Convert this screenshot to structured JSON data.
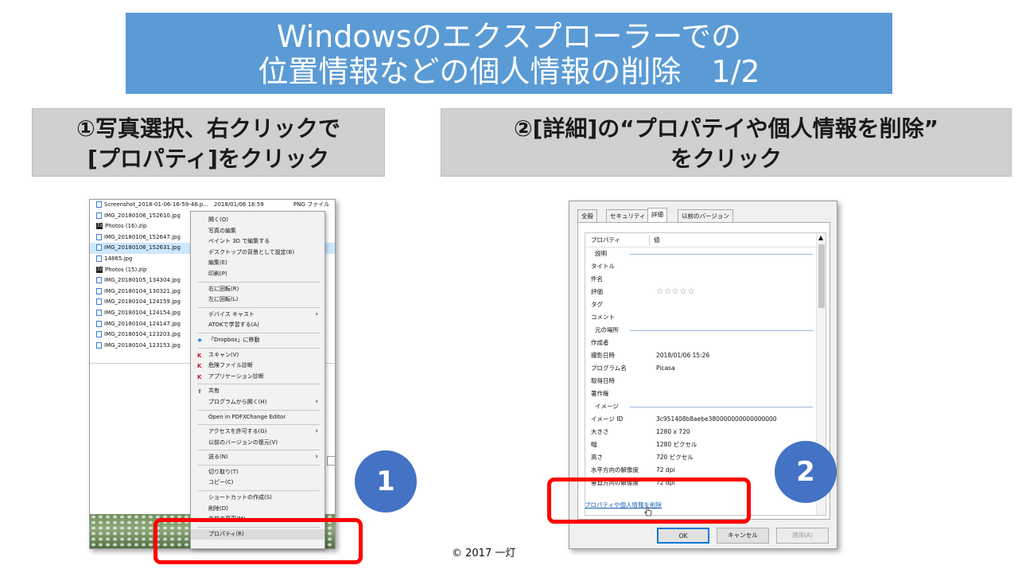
{
  "title": {
    "line1": "Windowsのエクスプローラーでの",
    "line2": "位置情報などの個人情報の削除　1/2"
  },
  "step1": {
    "line1": "①写真選択、右クリックで",
    "line2": "[プロパティ]をクリック"
  },
  "step2": {
    "line1": "②[詳細]の“プロパテイや個人情報を削除”",
    "line2": "をクリック"
  },
  "markers": {
    "one": "1",
    "two": "2"
  },
  "copyright": "© 2017 一灯",
  "explorer": {
    "files": [
      {
        "name": "Screenshot_2018-01-06-16-59-46.p...",
        "date": "2018/01/06 16:59",
        "type": "PNG ファイル",
        "icon": "image-file-icon"
      },
      {
        "name": "IMG_20180106_152610.jpg",
        "icon": "image-file-icon"
      },
      {
        "name": "Photos (16).zip",
        "icon": "zip-file-icon"
      },
      {
        "name": "IMG_20180106_152647.jpg",
        "icon": "image-file-icon"
      },
      {
        "name": "IMG_20180106_152631.jpg",
        "icon": "image-file-icon",
        "selected": true
      },
      {
        "name": "14865.jpg",
        "icon": "image-file-icon"
      },
      {
        "name": "Photos (15).zip",
        "icon": "zip-file-icon"
      },
      {
        "name": "IMG_20180105_134304.jpg",
        "icon": "image-file-icon"
      },
      {
        "name": "IMG_20180104_130321.jpg",
        "icon": "image-file-icon"
      },
      {
        "name": "IMG_20180104_124159.jpg",
        "icon": "image-file-icon"
      },
      {
        "name": "IMG_20180104_124154.jpg",
        "icon": "image-file-icon"
      },
      {
        "name": "IMG_20180104_124147.jpg",
        "icon": "image-file-icon"
      },
      {
        "name": "IMG_20180104_123203.jpg",
        "icon": "image-file-icon"
      },
      {
        "name": "IMG_20180104_123153.jpg",
        "icon": "image-file-icon"
      }
    ]
  },
  "context_menu": {
    "items": [
      {
        "label": "開く(O)"
      },
      {
        "label": "写真の編集"
      },
      {
        "label": "ペイント 3D で編集する"
      },
      {
        "label": "デスクトップの背景として設定(B)"
      },
      {
        "label": "編集(E)"
      },
      {
        "label": "印刷(P)"
      },
      {
        "sep": true
      },
      {
        "label": "右に回転(R)"
      },
      {
        "label": "左に回転(L)"
      },
      {
        "sep": true
      },
      {
        "label": "デバイス キャスト",
        "submenu": true
      },
      {
        "label": "ATOKで学習する(A)"
      },
      {
        "sep": true
      },
      {
        "label": "「Dropbox」に移動",
        "icon": "dropbox-icon",
        "glyph": "❖",
        "color": "#0061ff"
      },
      {
        "sep": true
      },
      {
        "label": "スキャン(V)",
        "icon": "kaspersky-icon",
        "glyph": "K",
        "color": "#c8102e"
      },
      {
        "label": "危険ファイル診断",
        "icon": "kaspersky-icon",
        "glyph": "K",
        "color": "#c8102e"
      },
      {
        "label": "アプリケーション診断",
        "icon": "kaspersky-icon",
        "glyph": "K",
        "color": "#c8102e"
      },
      {
        "sep": true
      },
      {
        "label": "共有",
        "icon": "share-icon",
        "glyph": "⇪",
        "color": "#333333"
      },
      {
        "label": "プログラムから開く(H)",
        "submenu": true
      },
      {
        "sep": true
      },
      {
        "label": "Open in PDFXChange Editor"
      },
      {
        "sep": true
      },
      {
        "label": "アクセスを許可する(G)",
        "submenu": true
      },
      {
        "label": "以前のバージョンの復元(V)"
      },
      {
        "sep": true
      },
      {
        "label": "送る(N)",
        "submenu": true
      },
      {
        "sep": true
      },
      {
        "label": "切り取り(T)"
      },
      {
        "label": "コピー(C)"
      },
      {
        "sep": true
      },
      {
        "label": "ショートカットの作成(S)"
      },
      {
        "label": "削除(D)"
      },
      {
        "label": "名前の変更(M)"
      },
      {
        "sep": true
      },
      {
        "label": "プロパティ(R)",
        "highlight": true
      }
    ]
  },
  "properties_dialog": {
    "tabs": [
      "全般",
      "セキュリティ",
      "詳細",
      "以前のバージョン"
    ],
    "active_tab": "詳細",
    "col_property": "プロパティ",
    "col_value": "値",
    "rows": [
      {
        "section": "説明"
      },
      {
        "name": "タイトル",
        "value": ""
      },
      {
        "name": "件名",
        "value": ""
      },
      {
        "name": "評価",
        "value": "☆☆☆☆☆",
        "stars": true
      },
      {
        "name": "タグ",
        "value": ""
      },
      {
        "name": "コメント",
        "value": ""
      },
      {
        "section": "元の場所"
      },
      {
        "name": "作成者",
        "value": ""
      },
      {
        "name": "撮影日時",
        "value": "2018/01/06 15:26"
      },
      {
        "name": "プログラム名",
        "value": "Picasa"
      },
      {
        "name": "取得日時",
        "value": ""
      },
      {
        "name": "著作権",
        "value": ""
      },
      {
        "section": "イメージ"
      },
      {
        "name": "イメージ ID",
        "value": "3c951408b8aebe380000000000000000"
      },
      {
        "name": "大きさ",
        "value": "1280 x 720"
      },
      {
        "name": "幅",
        "value": "1280 ピクセル"
      },
      {
        "name": "高さ",
        "value": "720 ピクセル"
      },
      {
        "name": "水平方向の解像度",
        "value": "72 dpi"
      },
      {
        "name": "垂直方向の解像度",
        "value": "72 dpi"
      }
    ],
    "remove_link": "プロパティや個人情報を削除",
    "buttons": {
      "ok": "OK",
      "cancel": "キャンセル",
      "apply": "適用(A)"
    }
  },
  "colors": {
    "title_bg": "#5b9bd5",
    "step_bg": "#d0d0d0",
    "highlight_red": "#ff0000",
    "marker_blue": "#4472c4"
  }
}
